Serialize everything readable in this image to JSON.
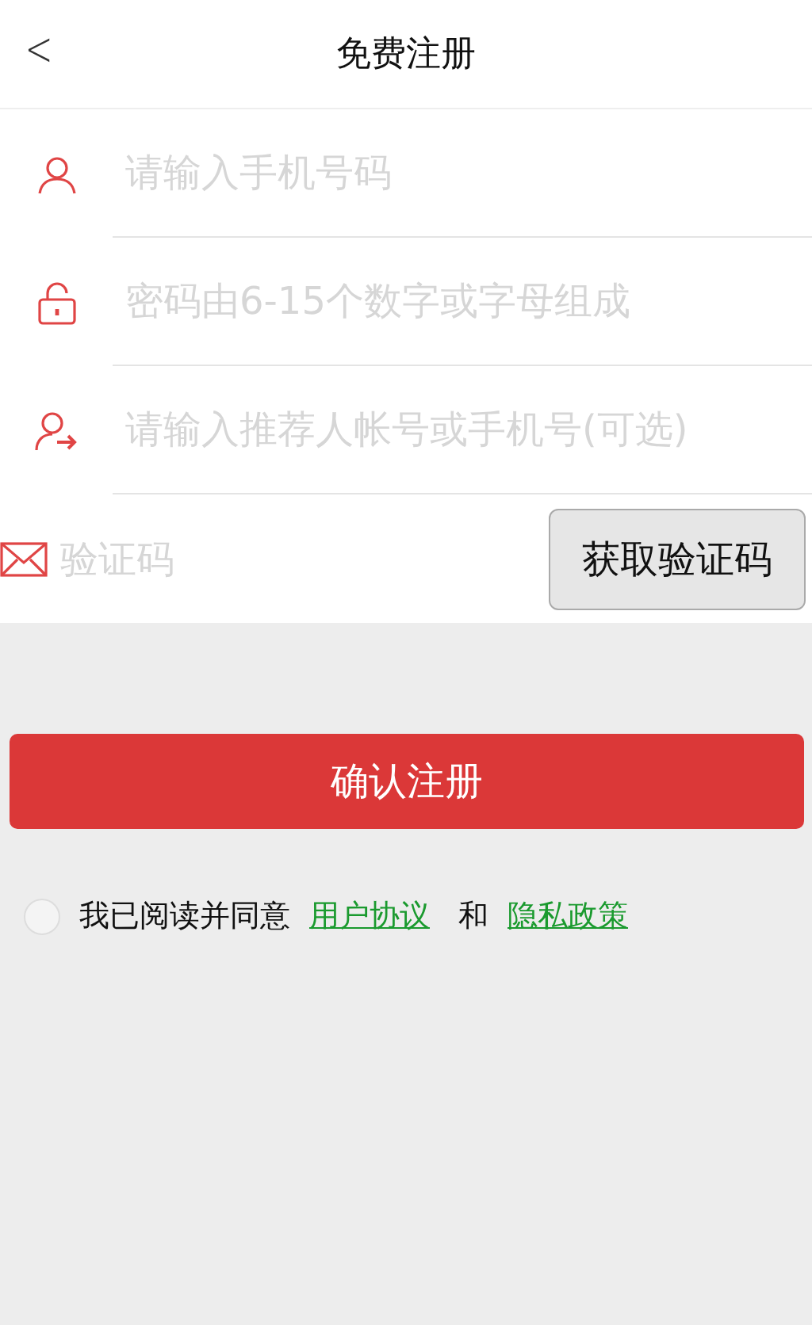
{
  "header": {
    "back": "<",
    "title": "免费注册"
  },
  "fields": [
    {
      "kind": "user",
      "placeholder": "请输入手机号码"
    },
    {
      "kind": "lock",
      "placeholder": "密码由6-15个数字或字母组成"
    },
    {
      "kind": "referrer",
      "placeholder": "请输入推荐人帐号或手机号(可选)"
    },
    {
      "kind": "mail",
      "placeholder": "验证码",
      "button": "获取验证码"
    }
  ],
  "submit": "确认注册",
  "agreement": {
    "checked": false,
    "text": "我已阅读并同意",
    "link1": "用户协议",
    "joiner": "和",
    "link2": "隐私政策"
  }
}
